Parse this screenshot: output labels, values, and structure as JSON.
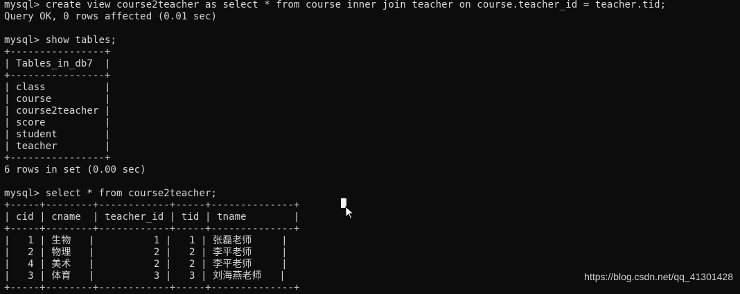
{
  "terminal": {
    "lines": [
      "mysql> create view course2teacher as select * from course inner join teacher on course.teacher_id = teacher.tid;",
      "Query OK, 0 rows affected (0.01 sec)",
      "",
      "mysql> show tables;",
      "+----------------+",
      "| Tables_in_db7  |",
      "+----------------+",
      "| class          |",
      "| course         |",
      "| course2teacher |",
      "| score          |",
      "| student        |",
      "| teacher        |",
      "+----------------+",
      "6 rows in set (0.00 sec)",
      "",
      "mysql> select * from course2teacher;",
      "+-----+--------+------------+-----+--------------+",
      "| cid | cname  | teacher_id | tid | tname        |",
      "+-----+--------+------------+-----+--------------+",
      "|   1 | 生物   |          1 |   1 | 张磊老师     |",
      "|   2 | 物理   |          2 |   2 | 李平老师     |",
      "|   4 | 美术   |          2 |   2 | 李平老师     |",
      "|   3 | 体育   |          3 |   3 | 刘海燕老师   |",
      "+-----+--------+------------+-----+--------------+"
    ]
  },
  "watermark": "https://blog.csdn.net/qq_41301428",
  "colors": {
    "background": "#0c0c0c",
    "text": "#d8d8d8",
    "cursor": "#f2f2f2"
  }
}
